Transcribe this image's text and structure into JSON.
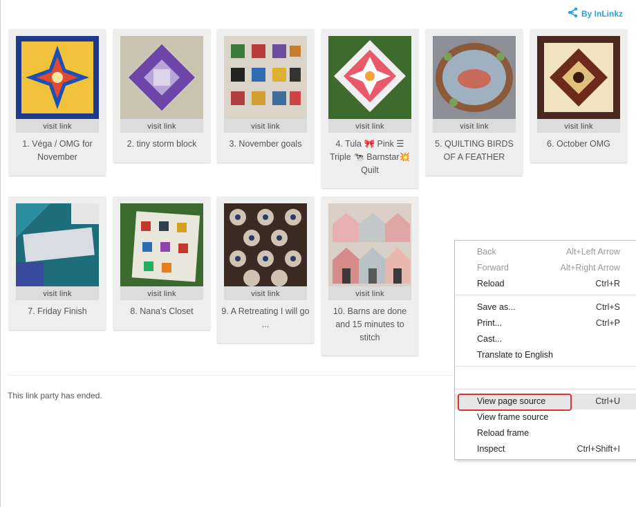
{
  "brand": {
    "label": "By InLinkz",
    "color": "#2aa0d8"
  },
  "visit_label": "visit link",
  "entries": [
    {
      "title": "1. Véga / OMG for November"
    },
    {
      "title": "2. tiny storm block"
    },
    {
      "title": "3. November goals"
    },
    {
      "title": "4. Tula 🎀 Pink ☰ Triple 🐄 Barnstar💥 Quilt"
    },
    {
      "title": "5. QUILTING BIRDS OF A FEATHER"
    },
    {
      "title": "6. October OMG"
    },
    {
      "title": "7. Friday Finish"
    },
    {
      "title": "8. Nana's Closet"
    },
    {
      "title": "9. A Retreating I will go ..."
    },
    {
      "title": "10. Barns are done and 15 minutes to stitch"
    }
  ],
  "footer_text": "This link party has ended.",
  "context_menu": {
    "items": [
      {
        "label": "Back",
        "shortcut": "Alt+Left Arrow"
      },
      {
        "label": "Forward",
        "shortcut": "Alt+Right Arrow"
      },
      {
        "label": "Reload",
        "shortcut": "Ctrl+R"
      },
      {
        "label": "Save as...",
        "shortcut": "Ctrl+S"
      },
      {
        "label": "Print...",
        "shortcut": "Ctrl+P"
      },
      {
        "label": "Cast..."
      },
      {
        "label": "Translate to English"
      },
      {
        "label": "View page source",
        "shortcut": "Ctrl+U"
      },
      {
        "label": "View frame source"
      },
      {
        "label": "Reload frame"
      },
      {
        "label": "Inspect",
        "shortcut": "Ctrl+Shift+I"
      }
    ]
  },
  "highlight_color": "#e03030"
}
